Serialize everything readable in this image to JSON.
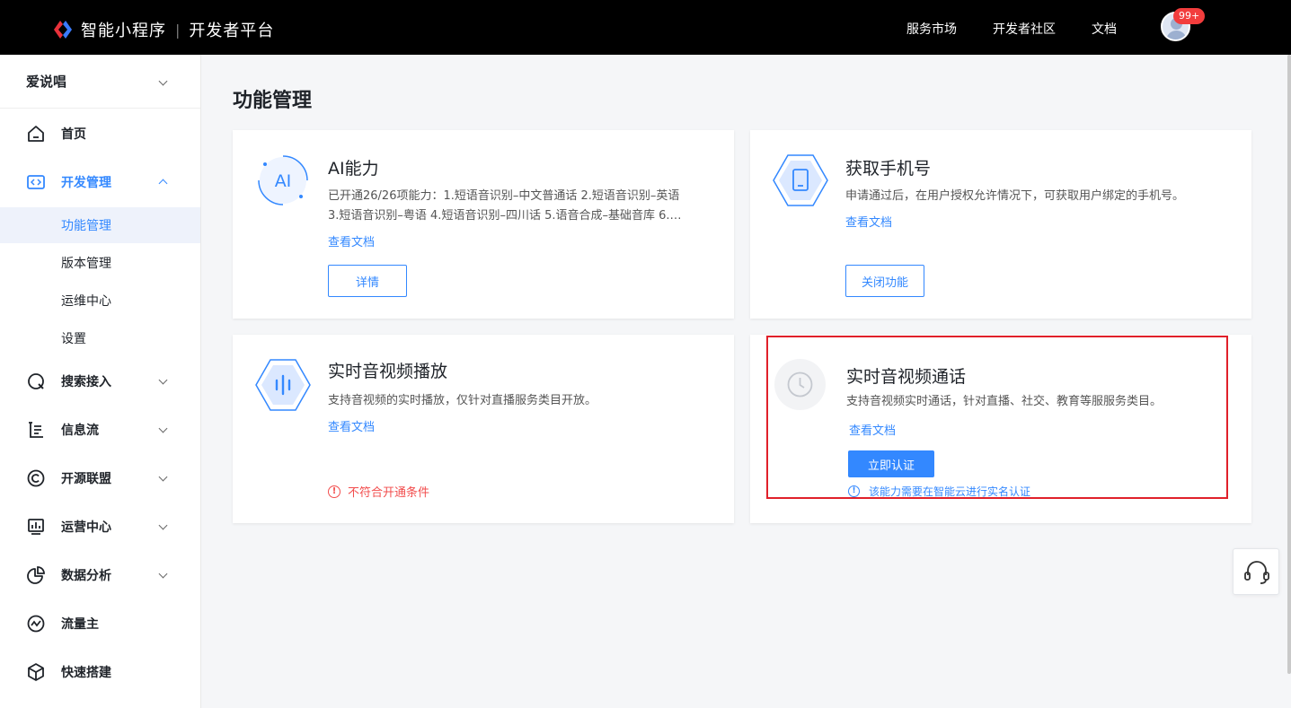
{
  "header": {
    "brand": "智能小程序",
    "separator": "|",
    "platform": "开发者平台",
    "nav": [
      "服务市场",
      "开发者社区",
      "文档"
    ],
    "badge": "99+"
  },
  "sidebar": {
    "app_name": "爱说唱",
    "items": [
      {
        "label": "首页",
        "icon": "home-icon"
      },
      {
        "label": "开发管理",
        "icon": "code-icon"
      },
      {
        "label": "搜索接入",
        "icon": "search-icon"
      },
      {
        "label": "信息流",
        "icon": "feed-icon"
      },
      {
        "label": "开源联盟",
        "icon": "copyright-icon"
      },
      {
        "label": "运营中心",
        "icon": "dashboard-icon"
      },
      {
        "label": "数据分析",
        "icon": "pie-chart-icon"
      },
      {
        "label": "流量主",
        "icon": "trend-icon"
      },
      {
        "label": "快速搭建",
        "icon": "cube-icon"
      }
    ],
    "sub_items": [
      "功能管理",
      "版本管理",
      "运维中心",
      "设置"
    ]
  },
  "main": {
    "title": "功能管理",
    "cards": [
      {
        "title": "AI能力",
        "icon_text": "AI",
        "desc1": "已开通26/26项能力：1.短语音识别–中文普通话 2.短语音识别–英语",
        "desc2": "3.短语音识别–粤语 4.短语音识别–四川话 5.语音合成–基础音库 6.…",
        "link": "查看文档",
        "button": "详情"
      },
      {
        "title": "获取手机号",
        "desc1": "申请通过后，在用户授权允许情况下，可获取用户绑定的手机号。",
        "link": "查看文档",
        "button": "关闭功能"
      },
      {
        "title": "实时音视频播放",
        "desc1": "支持音视频的实时播放，仅针对直播服务类目开放。",
        "link": "查看文档",
        "warning": "不符合开通条件"
      },
      {
        "title": "实时音视频通话",
        "desc1": "支持音视频实时通话，针对直播、社交、教育等服服务类目。",
        "link": "查看文档",
        "button": "立即认证",
        "note": "该能力需要在智能云进行实名认证"
      }
    ]
  },
  "colors": {
    "accent": "#3388ff",
    "warning": "#f24d4d",
    "highlight": "#e0202a"
  }
}
